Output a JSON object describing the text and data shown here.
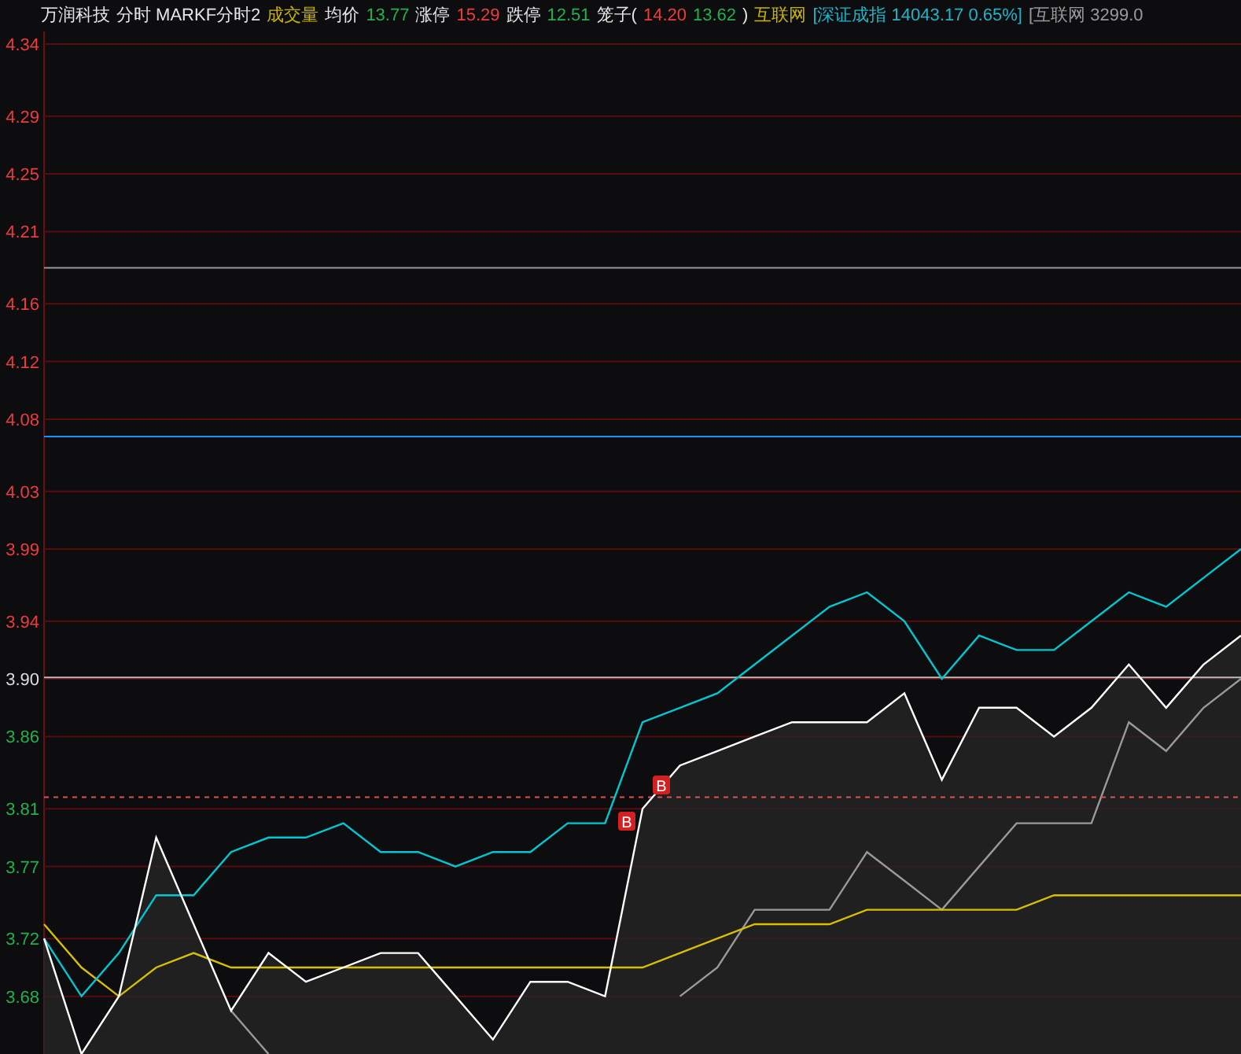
{
  "header": [
    {
      "text": "万润科技",
      "color": "#e6e6e6"
    },
    {
      "text": "分时 MARKF分时2",
      "color": "#e6e6e6"
    },
    {
      "text": "成交量",
      "color": "#c8b400"
    },
    {
      "text": "均价",
      "color": "#e6e6e6"
    },
    {
      "text": "13.77",
      "color": "#22b14c"
    },
    {
      "text": "涨停",
      "color": "#e6e6e6"
    },
    {
      "text": "15.29",
      "color": "#ee3b3b"
    },
    {
      "text": "跌停",
      "color": "#e6e6e6"
    },
    {
      "text": "12.51",
      "color": "#22b14c"
    },
    {
      "text": "笼子(",
      "color": "#e6e6e6"
    },
    {
      "text": "14.20",
      "color": "#ee3b3b"
    },
    {
      "text": "13.62",
      "color": "#22b14c"
    },
    {
      "text": ")",
      "color": "#e6e6e6"
    },
    {
      "text": "互联网",
      "color": "#c8b400"
    },
    {
      "text": "[深证成指 14043.17 0.65%]",
      "color": "#1eb4c8"
    },
    {
      "text": "[互联网 3299.0",
      "color": "#999999"
    }
  ],
  "chart": {
    "chart_data": {
      "type": "line",
      "categories": [
        null,
        null,
        null,
        null,
        null,
        null,
        null,
        null,
        null,
        null,
        null,
        null,
        null,
        null,
        null,
        null,
        null,
        null,
        null,
        null,
        null,
        null,
        null,
        null,
        null,
        null,
        null,
        null,
        null,
        null,
        null,
        null,
        null
      ],
      "ylim": [
        3.64,
        4.34
      ],
      "yticks": [
        4.34,
        4.29,
        4.25,
        4.21,
        4.16,
        4.12,
        4.08,
        4.03,
        3.99,
        3.94,
        {
          "value": 3.9,
          "label": "3.90"
        },
        3.86,
        3.81,
        3.77,
        3.72,
        3.68
      ],
      "grid": true,
      "series": [
        {
          "color": "#ffffff",
          "values": [
            3.72,
            3.64,
            3.68,
            3.79,
            3.73,
            3.67,
            3.71,
            3.69,
            3.7,
            3.71,
            3.71,
            3.68,
            3.65,
            3.69,
            3.69,
            3.68,
            3.81,
            3.84,
            3.85,
            3.86,
            3.87,
            3.87,
            3.87,
            3.89,
            3.83,
            3.88,
            3.88,
            3.86,
            3.88,
            3.91,
            3.88,
            3.91,
            3.93
          ]
        },
        {
          "color": "#00c8d2",
          "values": [
            3.72,
            3.68,
            3.71,
            3.75,
            3.75,
            3.78,
            3.79,
            3.79,
            3.8,
            3.78,
            3.78,
            3.77,
            3.78,
            3.78,
            3.8,
            3.8,
            3.87,
            3.88,
            3.89,
            3.91,
            3.93,
            3.95,
            3.96,
            3.94,
            3.9,
            3.93,
            3.92,
            3.92,
            3.94,
            3.96,
            3.95,
            3.97,
            3.99
          ]
        },
        {
          "color": "#d8c000",
          "values": [
            3.73,
            3.7,
            3.68,
            3.7,
            3.71,
            3.7,
            3.7,
            3.7,
            3.7,
            3.7,
            3.7,
            3.7,
            3.7,
            3.7,
            3.7,
            3.7,
            3.7,
            3.71,
            3.72,
            3.73,
            3.73,
            3.73,
            3.74,
            3.74,
            3.74,
            3.74,
            3.74,
            3.75,
            3.75,
            3.75,
            3.75,
            3.75,
            3.75
          ]
        },
        {
          "color": "#9a9a9a",
          "values": [
            4.185,
            4.185,
            4.185,
            4.185,
            4.185,
            4.185,
            4.185,
            4.185,
            4.185,
            4.185,
            4.185,
            4.185,
            4.185,
            4.185,
            4.185,
            4.185,
            4.185,
            4.185,
            4.185,
            4.185,
            4.185,
            4.185,
            4.185,
            4.185,
            4.185,
            4.185,
            4.185,
            4.185,
            4.185,
            4.185,
            4.185,
            4.185,
            4.185
          ]
        },
        {
          "color": "#1e90ff",
          "values": [
            4.068,
            4.068,
            4.068,
            4.068,
            4.068,
            4.068,
            4.068,
            4.068,
            4.068,
            4.068,
            4.068,
            4.068,
            4.068,
            4.068,
            4.068,
            4.068,
            4.068,
            4.068,
            4.068,
            4.068,
            4.068,
            4.068,
            4.068,
            4.068,
            4.068,
            4.068,
            4.068,
            4.068,
            4.068,
            4.068,
            4.068,
            4.068,
            4.068
          ]
        },
        {
          "color": "#bbbbbb",
          "values": [
            3.901,
            3.901,
            3.901,
            3.901,
            3.901,
            3.901,
            3.901,
            3.901,
            3.901,
            3.901,
            3.901,
            3.901,
            3.901,
            3.901,
            3.901,
            3.901,
            3.901,
            3.901,
            3.901,
            3.901,
            3.901,
            3.901,
            3.901,
            3.901,
            3.901,
            3.901,
            3.901,
            3.901,
            3.901,
            3.901,
            3.901,
            3.901,
            3.901
          ]
        },
        {
          "color": "#e05050",
          "line_style": "dashed",
          "values": [
            3.818,
            3.818,
            3.818,
            3.818,
            3.818,
            3.818,
            3.818,
            3.818,
            3.818,
            3.818,
            3.818,
            3.818,
            3.818,
            3.818,
            3.818,
            3.818,
            3.818,
            3.818,
            3.818,
            3.818,
            3.818,
            3.818,
            3.818,
            3.818,
            3.818,
            3.818,
            3.818,
            3.818,
            3.818,
            3.818,
            3.818,
            3.818,
            3.818
          ]
        },
        {
          "color": "#9a9a9a",
          "values": [
            null,
            null,
            null,
            null,
            null,
            3.67,
            3.64,
            null,
            null,
            null,
            null,
            null,
            null,
            null,
            null,
            null,
            null,
            3.68,
            3.7,
            3.74,
            3.74,
            3.74,
            3.78,
            3.76,
            3.74,
            3.77,
            3.8,
            3.8,
            3.8,
            3.87,
            3.85,
            3.88,
            3.9
          ]
        }
      ]
    },
    "trade_marks": [
      {
        "text": "B"
      },
      {
        "text": "B"
      }
    ]
  }
}
